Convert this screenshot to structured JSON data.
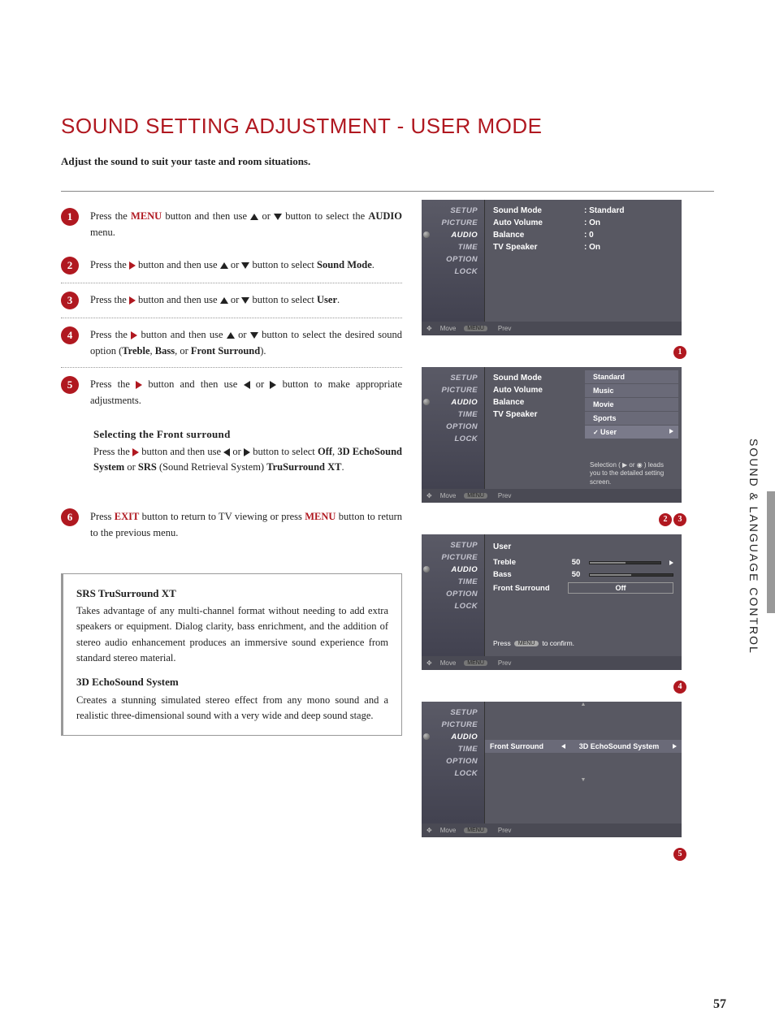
{
  "title": "SOUND SETTING ADJUSTMENT - USER MODE",
  "intro": "Adjust the sound to suit your taste and room situations.",
  "sideLabel": "SOUND & LANGUAGE CONTROL",
  "pageNumber": "57",
  "steps": {
    "s1": {
      "num": "1",
      "t1": "Press the ",
      "menu": "MENU",
      "t2": " button and then use ",
      "t3": " or ",
      "t4": " button to select the ",
      "audio": "AUDIO",
      "t5": " menu."
    },
    "s2": {
      "num": "2",
      "t1": "Press the ",
      "t2": " button and then use ",
      "t3": " or ",
      "t4": " button to select ",
      "target": "Sound Mode",
      "t5": "."
    },
    "s3": {
      "num": "3",
      "t1": "Press the ",
      "t2": " button and then use ",
      "t3": " or ",
      "t4": " button to select ",
      "target": "User",
      "t5": "."
    },
    "s4": {
      "num": "4",
      "t1": "Press the ",
      "t2": " button and then use ",
      "t3": " or ",
      "t4": " button to select the desired sound option (",
      "opt1": "Treble",
      "c1": ", ",
      "opt2": "Bass",
      "c2": ", or ",
      "opt3": "Front Surround",
      "t5": ")."
    },
    "s5": {
      "num": "5",
      "t1": "Press the ",
      "t2": " button and then use ",
      "t3": " or ",
      "t4": " button to make appropriate adjustments."
    },
    "s6": {
      "num": "6",
      "t1": "Press ",
      "exit": "EXIT",
      "t2": " button to return to TV viewing or press ",
      "menu": "MENU",
      "t3": " button to return to the previous menu."
    }
  },
  "frontSurround": {
    "head": "Selecting the Front surround",
    "t1": "Press the ",
    "t2": " button and then use ",
    "t3": " or ",
    "t4": " button to select ",
    "opt1": "Off",
    "c1": ", ",
    "opt2": "3D EchoSound System",
    "c2": " or ",
    "opt3": "SRS",
    "t5": " (Sound Retrieval System) ",
    "opt4": "TruSurround XT",
    "t6": "."
  },
  "infobox": {
    "h1": "SRS TruSurround XT",
    "p1": "Takes advantage of any multi-channel format without needing to add extra speakers or equipment. Dialog clarity, bass enrichment, and the addition of stereo audio enhancement produces an immersive sound experience from standard stereo material.",
    "h2": "3D EchoSound System",
    "p2": "Creates a stunning simulated stereo effect from any mono sound and a realistic three-dimensional sound with a very wide and deep sound stage."
  },
  "osdMenu": [
    "SETUP",
    "PICTURE",
    "AUDIO",
    "TIME",
    "OPTION",
    "LOCK"
  ],
  "osdFoot": {
    "move": "Move",
    "prev": "Prev",
    "menuKey": "MENU"
  },
  "osd1": {
    "rows": [
      {
        "lbl": "Sound Mode",
        "val": ": Standard"
      },
      {
        "lbl": "Auto Volume",
        "val": ": On"
      },
      {
        "lbl": "Balance",
        "val": ": 0"
      },
      {
        "lbl": "TV Speaker",
        "val": ": On"
      }
    ],
    "badge": "1"
  },
  "osd2": {
    "rows": [
      "Sound Mode",
      "Auto Volume",
      "Balance",
      "TV Speaker"
    ],
    "options": [
      "Standard",
      "Music",
      "Movie",
      "Sports",
      "User"
    ],
    "selected": "User",
    "hint": "Selection ( ▶ or ◉ ) leads you to the detailed setting screen.",
    "badges": [
      "2",
      "3"
    ]
  },
  "osd3": {
    "title": "User",
    "rows": [
      {
        "lbl": "Treble",
        "val": "50",
        "type": "slider"
      },
      {
        "lbl": "Bass",
        "val": "50",
        "type": "slider"
      },
      {
        "lbl": "Front Surround",
        "val": "Off",
        "type": "box"
      }
    ],
    "confirm1": "Press",
    "confirmKey": "MENU",
    "confirm2": "to confirm.",
    "badge": "4"
  },
  "osd4": {
    "lbl": "Front Surround",
    "val": "3D EchoSound System",
    "badge": "5"
  }
}
